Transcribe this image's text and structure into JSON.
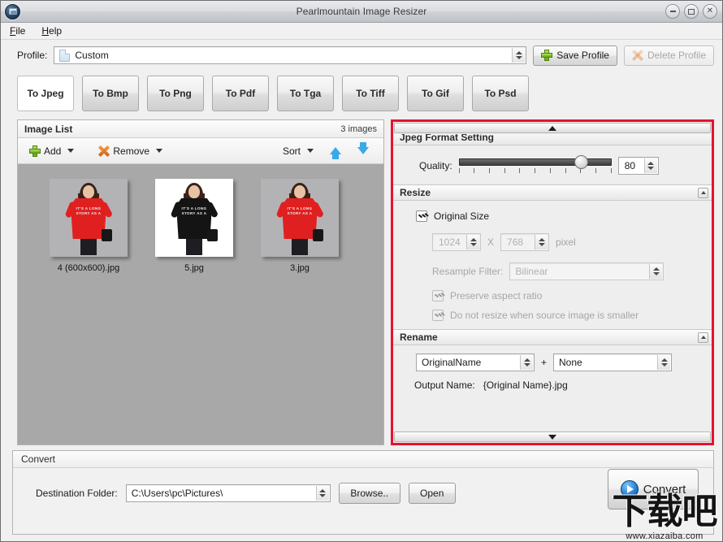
{
  "window": {
    "title": "Pearlmountain Image Resizer",
    "app_icon": "picture-app-icon",
    "minimize_label": "–",
    "maximize_label": "□",
    "close_label": "✕"
  },
  "menubar": {
    "items": [
      {
        "label": "File",
        "mnemonic": "F"
      },
      {
        "label": "Help",
        "mnemonic": "H"
      }
    ]
  },
  "profile": {
    "label": "Profile:",
    "value": "Custom",
    "icon": "document-icon",
    "save_label": "Save Profile",
    "save_icon": "green-plus-icon",
    "delete_label": "Delete Profile",
    "delete_icon": "orange-x-icon",
    "delete_disabled": true
  },
  "format_tabs": [
    {
      "label": "To Jpeg",
      "active": true
    },
    {
      "label": "To Bmp",
      "active": false
    },
    {
      "label": "To Png",
      "active": false
    },
    {
      "label": "To Pdf",
      "active": false
    },
    {
      "label": "To Tga",
      "active": false
    },
    {
      "label": "To Tiff",
      "active": false
    },
    {
      "label": "To Gif",
      "active": false
    },
    {
      "label": "To Psd",
      "active": false
    }
  ],
  "image_list": {
    "title": "Image List",
    "count_text": "3 images",
    "toolbar": {
      "add_label": "Add",
      "add_icon": "green-plus-icon",
      "remove_label": "Remove",
      "remove_icon": "orange-x-icon",
      "sort_label": "Sort",
      "move_up_icon": "blue-arrow-up-icon",
      "move_down_icon": "blue-arrow-down-icon"
    },
    "thumbnails": [
      {
        "filename": "4 (600x600).jpg",
        "background": "gray",
        "dress_color": "red",
        "shirt_text": "IT'S A LONG STORY AS A"
      },
      {
        "filename": "5.jpg",
        "background": "white",
        "dress_color": "black",
        "shirt_text": "IT'S A LONG STORY AS A"
      },
      {
        "filename": "3.jpg",
        "background": "gray",
        "dress_color": "red",
        "shirt_text": "IT'S A LONG STORY AS A"
      }
    ]
  },
  "settings": {
    "scroll_up_icon": "scroll-up-arrow",
    "scroll_down_icon": "scroll-down-arrow",
    "jpeg": {
      "title": "Jpeg Format Setting",
      "quality_label": "Quality:",
      "quality_value": "80",
      "quality_min": 0,
      "quality_max": 100,
      "tick_count": 11
    },
    "resize": {
      "title": "Resize",
      "original_size_label": "Original Size",
      "original_size_checked": true,
      "width_value": "1024",
      "height_value": "768",
      "separator": "X",
      "unit_label": "pixel",
      "resample_label": "Resample Filter:",
      "resample_value": "Bilinear",
      "preserve_aspect_label": "Preserve aspect ratio",
      "preserve_aspect_checked": true,
      "no_upscale_label": "Do not resize when source image is smaller",
      "no_upscale_checked": true,
      "fields_disabled": true
    },
    "rename": {
      "title": "Rename",
      "part1_value": "OriginalName",
      "plus_label": "+",
      "part2_value": "None",
      "output_label": "Output Name:",
      "output_value": "{Original Name}.jpg"
    }
  },
  "convert": {
    "title": "Convert",
    "destination_label": "Destination Folder:",
    "destination_value": "C:\\Users\\pc\\Pictures\\",
    "browse_label": "Browse..",
    "open_label": "Open",
    "convert_label": "Convert",
    "convert_icon": "blue-play-icon"
  },
  "watermark": {
    "text": "下载吧",
    "url": "www.xiazaiba.com"
  },
  "colors": {
    "highlight_border": "#e8112d",
    "accent_blue": "#3aa9e8",
    "plus_green": "#6aa81f",
    "remove_orange": "#d4601a"
  }
}
